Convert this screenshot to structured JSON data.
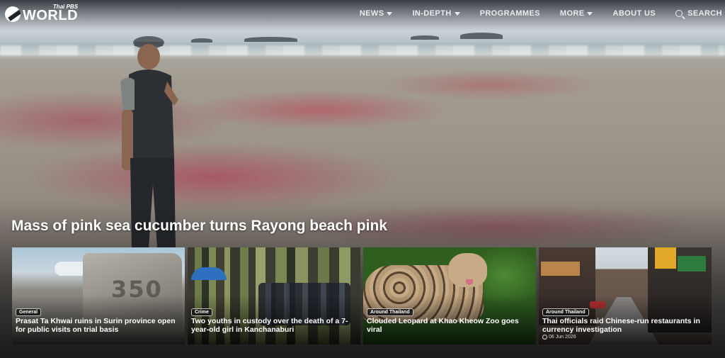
{
  "brand": {
    "small": "Thai PBS",
    "big": "WORLD"
  },
  "nav": {
    "items": [
      {
        "label": "NEWS",
        "has_dropdown": true
      },
      {
        "label": "IN-DEPTH",
        "has_dropdown": true
      },
      {
        "label": "PROGRAMMES",
        "has_dropdown": false
      },
      {
        "label": "MORE",
        "has_dropdown": true
      },
      {
        "label": "ABOUT US",
        "has_dropdown": false
      },
      {
        "label": "SEARCH",
        "has_dropdown": false,
        "icon": "search-icon"
      }
    ]
  },
  "hero": {
    "headline": "Mass of pink sea cucumber turns Rayong beach pink"
  },
  "cards": [
    {
      "category": "General",
      "title": "Prasat Ta Khwai ruins in Surin province open for public visits on trial basis",
      "date": "",
      "image_text": "350"
    },
    {
      "category": "Crime",
      "title": "Two youths in custody over the death of a 7-year-old girl in Kanchanaburi",
      "date": ""
    },
    {
      "category": "Around Thailand",
      "title": "Clouded Leopard at Khao Kheow Zoo goes viral",
      "date": ""
    },
    {
      "category": "Around Thailand",
      "title": "Thai officials raid Chinese-run restaurants in currency investigation",
      "date": "06 Jun 2026"
    }
  ]
}
